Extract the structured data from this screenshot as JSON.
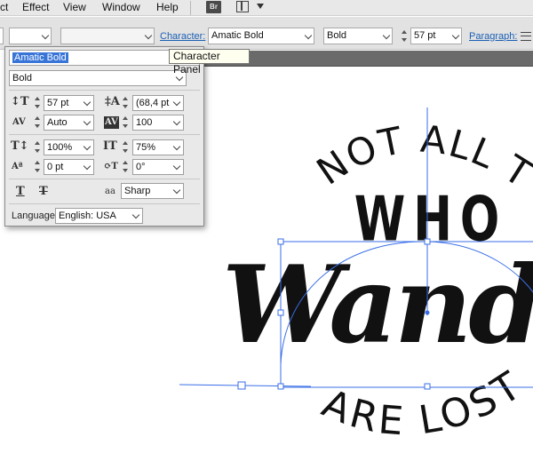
{
  "menu": {
    "items": [
      "ct",
      "Effect",
      "View",
      "Window",
      "Help"
    ],
    "bridge_badge": "Br"
  },
  "controlbar": {
    "character_link": "Character:",
    "font_family": "Amatic Bold",
    "font_style": "Bold",
    "font_size": "57 pt",
    "paragraph_link": "Paragraph:"
  },
  "tooltip": "Character Panel",
  "panel": {
    "font_family": "Amatic Bold",
    "font_style": "Bold",
    "font_size": "57 pt",
    "leading": "(68,4 pt",
    "kerning": "Auto",
    "tracking": "100",
    "vertical_scale": "100%",
    "horizontal_scale": "75%",
    "baseline_shift": "0 pt",
    "rotation": "0°",
    "anti_aliasing_glyph": "aa",
    "anti_aliasing": "Sharp",
    "language_label": "Language:",
    "language": "English: USA"
  },
  "artwork": {
    "line1": "NOT ALL THOSE",
    "line2": "WHO",
    "line3": "Wande",
    "line4": "ARE LOST",
    "path_color": "#3a6ee8"
  }
}
